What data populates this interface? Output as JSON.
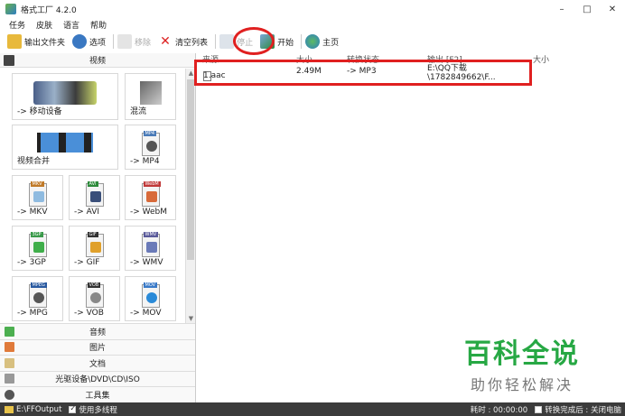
{
  "window": {
    "title": "格式工厂 4.2.0",
    "minimize": "–",
    "maximize": "□",
    "close": "✕"
  },
  "menu": [
    "任务",
    "皮肤",
    "语言",
    "帮助"
  ],
  "toolbar": {
    "output_folder": "输出文件夹",
    "options": "选项",
    "remove": "移除",
    "clear_list": "清空列表",
    "stop": "停止",
    "start": "开始",
    "home": "主页"
  },
  "left_panel": {
    "video_header": "视频",
    "tiles": [
      {
        "label": "-> 移动设备",
        "icon": "mobile-devices-icon"
      },
      {
        "label": "混流",
        "icon": "mux-icon"
      },
      {
        "label": "视频合并",
        "icon": "video-join-icon"
      },
      {
        "label": "-> MP4",
        "icon": "mp4-file-icon",
        "tag": "MP4"
      },
      {
        "label": "-> MKV",
        "icon": "mkv-file-icon",
        "tag": "MKV"
      },
      {
        "label": "-> AVI",
        "icon": "avi-file-icon",
        "tag": "AVI"
      },
      {
        "label": "-> WebM",
        "icon": "webm-file-icon",
        "tag": "WebM"
      },
      {
        "label": "-> 3GP",
        "icon": "3gp-file-icon",
        "tag": "3GP"
      },
      {
        "label": "-> GIF",
        "icon": "gif-file-icon",
        "tag": "GIF"
      },
      {
        "label": "-> WMV",
        "icon": "wmv-file-icon",
        "tag": "WMV"
      },
      {
        "label": "-> MPG",
        "icon": "mpg-file-icon",
        "tag": "MPEG"
      },
      {
        "label": "-> VOB",
        "icon": "vob-file-icon",
        "tag": "VOB"
      },
      {
        "label": "-> MOV",
        "icon": "mov-file-icon",
        "tag": "MOV"
      }
    ],
    "categories": [
      "音频",
      "图片",
      "文档",
      "光驱设备\\DVD\\CD\\ISO",
      "工具集"
    ]
  },
  "file_list": {
    "headers": [
      "来源",
      "大小",
      "转换状态",
      "输出 [F2]",
      "大小"
    ],
    "rows": [
      {
        "source": "1.aac",
        "size": "2.49M",
        "status": "-> MP3",
        "output": "E:\\QQ下载\\1782849662\\F..."
      }
    ]
  },
  "watermark": {
    "brand": "百科全说",
    "slogan": "助你轻松解决"
  },
  "status_bar": {
    "output_path": "E:\\FFOutput",
    "multithread": "使用多线程",
    "elapsed": "耗时 : 00:00:00",
    "shutdown": "转换完成后 : 关闭电脑"
  },
  "colors": {
    "highlight": "#e02020",
    "watermark_green": "#27a844",
    "status_bg": "#3b3b3b"
  }
}
